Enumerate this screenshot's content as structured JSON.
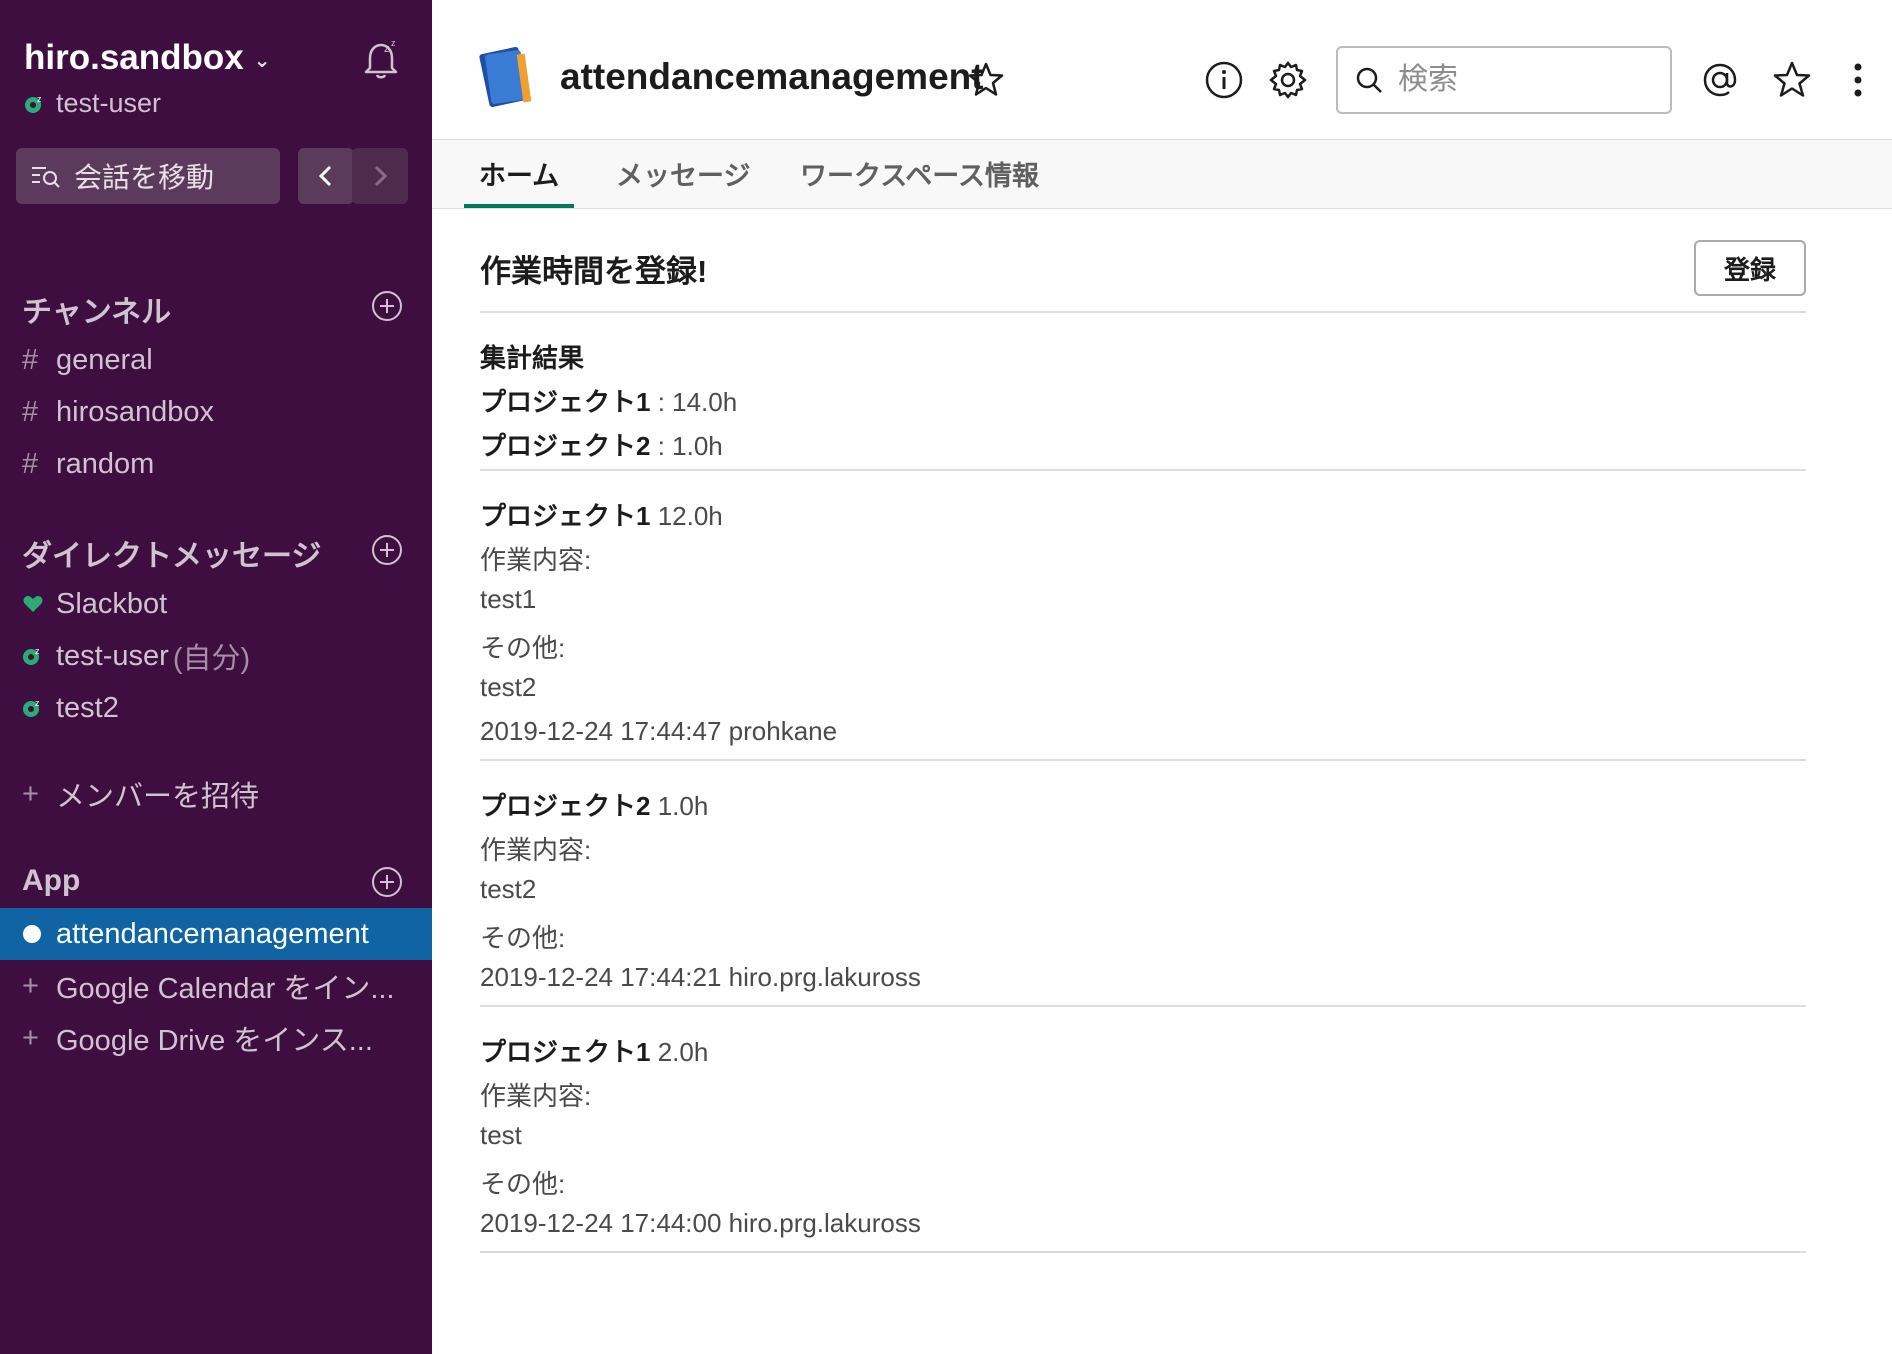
{
  "workspace": {
    "name": "hiro.sandbox",
    "user": "test-user"
  },
  "sidebar": {
    "jump_label": "会話を移動",
    "channels_title": "チャンネル",
    "channels": [
      {
        "label": "general"
      },
      {
        "label": "hirosandbox"
      },
      {
        "label": "random"
      }
    ],
    "dm_title": "ダイレクトメッセージ",
    "dms": [
      {
        "label": "Slackbot"
      },
      {
        "label": "test-user",
        "suffix": "(自分)"
      },
      {
        "label": "test2"
      }
    ],
    "invite_label": "メンバーを招待",
    "apps_title": "App",
    "apps": [
      {
        "label": "attendancemanagement",
        "active": true
      },
      {
        "label": "Google Calendar をイン..."
      },
      {
        "label": "Google Drive をインス..."
      }
    ]
  },
  "header": {
    "title": "attendancemanagement",
    "search_placeholder": "検索"
  },
  "tabs": [
    {
      "label": "ホーム",
      "active": true
    },
    {
      "label": "メッセージ"
    },
    {
      "label": "ワークスペース情報"
    }
  ],
  "home": {
    "title": "作業時間を登録!",
    "register_button": "登録",
    "summary": {
      "heading": "集計結果",
      "rows": [
        {
          "project": "プロジェクト1",
          "value": " : 14.0h"
        },
        {
          "project": "プロジェクト2",
          "value": " : 1.0h"
        }
      ]
    },
    "entries": [
      {
        "project": "プロジェクト1",
        "hours": " 12.0h",
        "content_label": "作業内容:",
        "content": "test1",
        "other_label": "その他:",
        "other": "test2",
        "meta": "2019-12-24 17:44:47 prohkane"
      },
      {
        "project": "プロジェクト2",
        "hours": " 1.0h",
        "content_label": "作業内容:",
        "content": "test2",
        "other_label": "その他:",
        "other": "",
        "meta": "2019-12-24 17:44:21 hiro.prg.lakuross"
      },
      {
        "project": "プロジェクト1",
        "hours": " 2.0h",
        "content_label": "作業内容:",
        "content": "test",
        "other_label": "その他:",
        "other": "",
        "meta": "2019-12-24 17:44:00 hiro.prg.lakuross"
      }
    ]
  },
  "colors": {
    "sidebar": "#3f0e40",
    "active_item": "#1164a3",
    "tab_underline": "#007a5a",
    "presence": "#2bac76"
  }
}
